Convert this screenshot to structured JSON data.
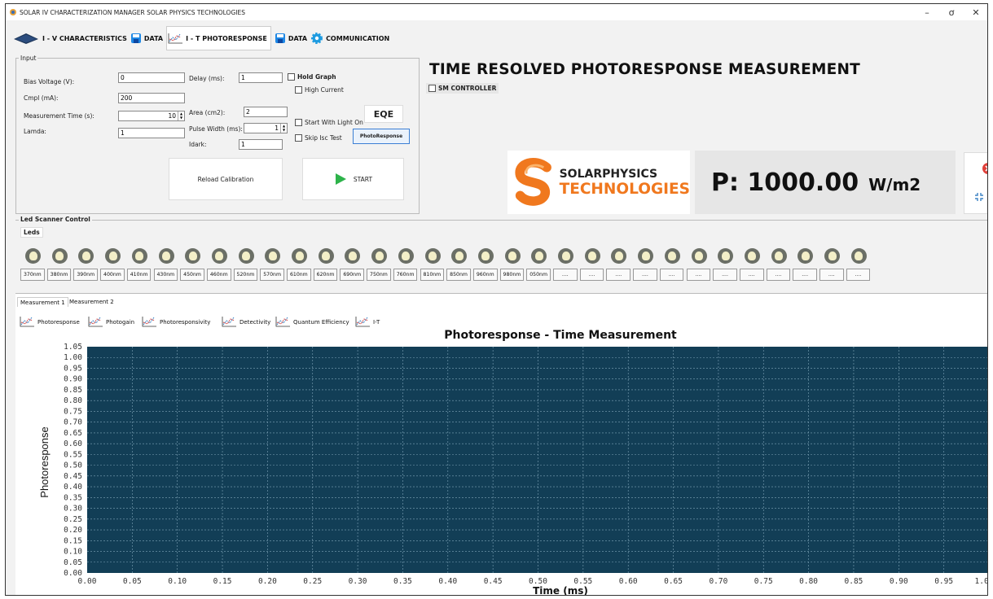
{
  "window": {
    "title": "SOLAR IV CHARACTERIZATION MANAGER SOLAR PHYSICS TECHNOLOGIES",
    "minimize": "–",
    "maximize": "ơ",
    "close": "✕"
  },
  "toolbar": {
    "iv": "I - V CHARACTERISTICS",
    "data1": "DATA",
    "it": "I - T PHOTORESPONSE",
    "data2": "DATA",
    "comm": "COMMUNICATION"
  },
  "input": {
    "legend": "Input",
    "bias_label": "Bias Voltage (V):",
    "bias_value": "0",
    "cmpl_label": "Cmpl (mA):",
    "cmpl_value": "200",
    "mtime_label": "Measurement Time (s):",
    "mtime_value": "10",
    "lamda_label": "Lamda:",
    "lamda_value": "1",
    "delay_label": "Delay (ms):",
    "delay_value": "1",
    "area_label": "Area (cm2):",
    "area_value": "2",
    "pulse_label": "Pulse Width (ms):",
    "pulse_value": "1",
    "idark_label": "Idark:",
    "idark_value": "1",
    "hold_graph": "Hold Graph",
    "high_current": "High Current",
    "start_light": "Start With Light On",
    "skip_isc": "Skip Isc Test",
    "eqe": "EQE",
    "photoresponse_btn": "PhotoResponse",
    "reload": "Reload Calibration",
    "start": "START"
  },
  "heading": "TIME RESOLVED PHOTORESPONSE  MEASUREMENT",
  "sm_controller": "SM CONTROLLER",
  "logo": {
    "line1": "SOLARPHYSICS",
    "line2": "TECHNOLOGIES"
  },
  "power": {
    "label": "P: 1000.00",
    "unit": "W/m2"
  },
  "leds": {
    "group": "Led Scanner Control",
    "tab": "Leds",
    "labels": [
      "370nm",
      "380nm",
      "390nm",
      "400nm",
      "410nm",
      "430nm",
      "450nm",
      "460nm",
      "520nm",
      "570nm",
      "610nm",
      "620nm",
      "690nm",
      "750nm",
      "760nm",
      "810nm",
      "850nm",
      "960nm",
      "980nm",
      "050nm",
      "....",
      "....",
      "....",
      "....",
      "....",
      "....",
      "....",
      "....",
      "....",
      "....",
      "....",
      "...."
    ]
  },
  "measurement": {
    "tabs": [
      "Measurement 1",
      "Measurement 2"
    ],
    "plot_tabs": [
      "Photoresponse",
      "Photogain",
      "Photoresponsivity",
      "Detectivity",
      "Quantum Efficiency",
      "I-T"
    ]
  },
  "colors": {
    "plot_bg": "#123e56",
    "gridline": "#7fa4b8",
    "led_bg": "#6b6f66",
    "start_arrow": "#2db34a",
    "logo_orange": "#f0781e"
  },
  "chart_data": {
    "type": "line",
    "title": "Photoresponse - Time Measurement",
    "xlabel": "Time (ms)",
    "ylabel": "Photoresponse",
    "xlim": [
      0,
      1
    ],
    "ylim": [
      0,
      1.05
    ],
    "xticks": [
      "0.00",
      "0.05",
      "0.10",
      "0.15",
      "0.20",
      "0.25",
      "0.30",
      "0.35",
      "0.40",
      "0.45",
      "0.50",
      "0.55",
      "0.60",
      "0.65",
      "0.70",
      "0.75",
      "0.80",
      "0.85",
      "0.90",
      "0.95",
      "1.00"
    ],
    "yticks": [
      "0.00",
      "0.05",
      "0.10",
      "0.15",
      "0.20",
      "0.25",
      "0.30",
      "0.35",
      "0.40",
      "0.45",
      "0.50",
      "0.55",
      "0.60",
      "0.65",
      "0.70",
      "0.75",
      "0.80",
      "0.85",
      "0.90",
      "0.95",
      "1.00",
      "1.05"
    ],
    "series": [],
    "grid": true
  }
}
